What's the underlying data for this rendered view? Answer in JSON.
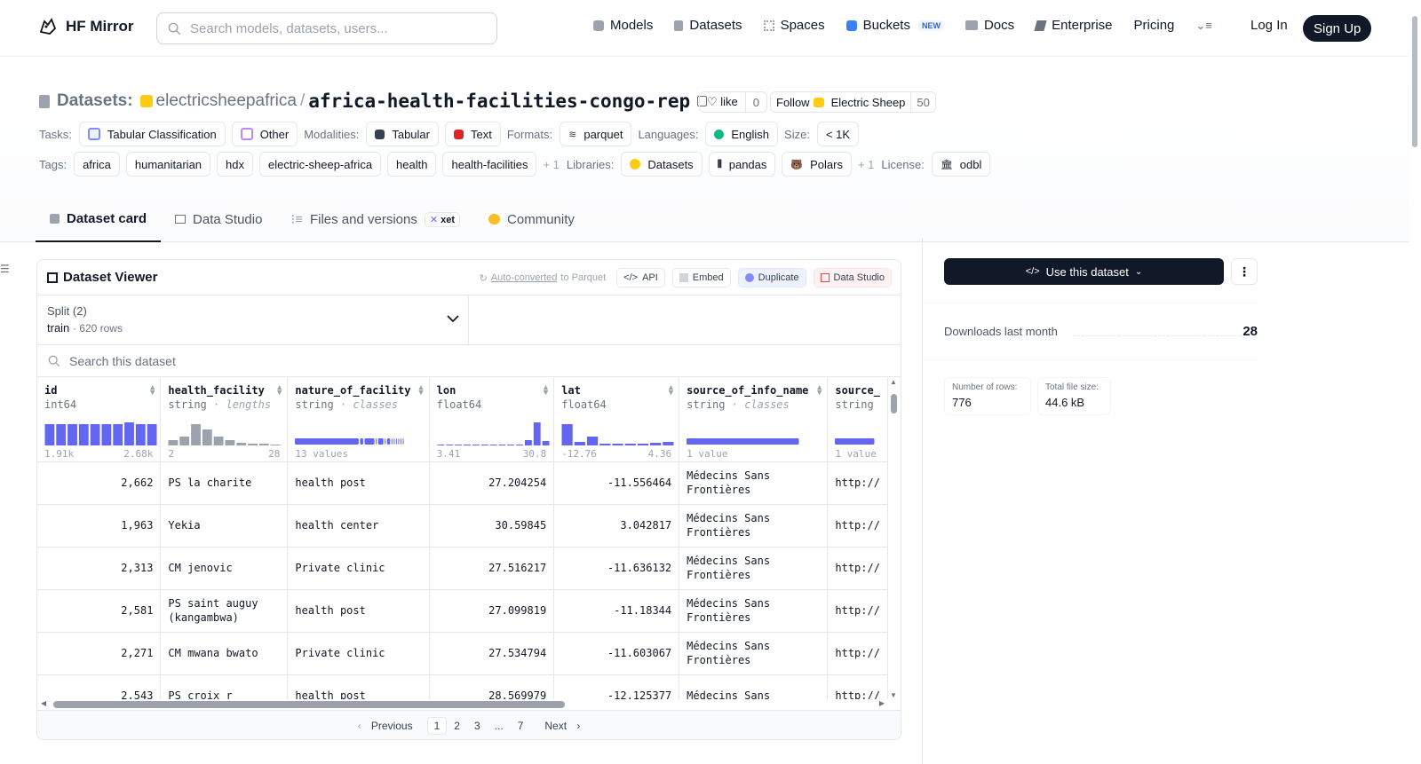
{
  "nav": {
    "brand": "HF Mirror",
    "search_placeholder": "Search models, datasets, users...",
    "links": [
      "Models",
      "Datasets",
      "Spaces",
      "Buckets",
      "Docs",
      "Enterprise",
      "Pricing"
    ],
    "buckets_badge": "NEW",
    "login": "Log In",
    "signup": "Sign Up"
  },
  "header": {
    "type_label": "Datasets:",
    "owner": "electricsheepafrica",
    "separator": "/",
    "name": "africa-health-facilities-congo-rep",
    "like_label": "like",
    "like_count": "0",
    "follow_label": "Follow",
    "follow_org": "Electric Sheep",
    "follow_count": "50"
  },
  "meta": {
    "tasks_label": "Tasks:",
    "tasks": [
      "Tabular Classification",
      "Other"
    ],
    "modalities_label": "Modalities:",
    "modalities": [
      "Tabular",
      "Text"
    ],
    "formats_label": "Formats:",
    "formats": [
      "parquet"
    ],
    "languages_label": "Languages:",
    "languages": [
      "English"
    ],
    "size_label": "Size:",
    "size": "< 1K",
    "tags_label": "Tags:",
    "tags": [
      "africa",
      "humanitarian",
      "hdx",
      "electric-sheep-africa",
      "health",
      "health-facilities"
    ],
    "tags_more": "+ 1",
    "libraries_label": "Libraries:",
    "libraries": [
      "Datasets",
      "pandas",
      "Polars"
    ],
    "libraries_more": "+ 1",
    "license_label": "License:",
    "license": "odbl"
  },
  "tabs": [
    "Dataset card",
    "Data Studio",
    "Files and versions",
    "Community"
  ],
  "xet_badge": "xet",
  "viewer": {
    "title": "Dataset Viewer",
    "auto_converted": "Auto-converted",
    "to_parquet": "to Parquet",
    "api": "API",
    "embed": "Embed",
    "duplicate": "Duplicate",
    "data_studio": "Data Studio",
    "split_label": "Split (2)",
    "split_value": "train",
    "split_rows": "620 rows",
    "search_placeholder": "Search this dataset",
    "columns": [
      {
        "name": "id",
        "type": "int64",
        "kind": "",
        "min": "1.91k",
        "max": "2.68k"
      },
      {
        "name": "health_facility",
        "type": "string",
        "kind": "lengths",
        "min": "2",
        "max": "28"
      },
      {
        "name": "nature_of_facility",
        "type": "string",
        "kind": "classes",
        "min": "13 values",
        "max": ""
      },
      {
        "name": "lon",
        "type": "float64",
        "kind": "",
        "min": "3.41",
        "max": "30.8"
      },
      {
        "name": "lat",
        "type": "float64",
        "kind": "",
        "min": "-12.76",
        "max": "4.36"
      },
      {
        "name": "source_of_info_name",
        "type": "string",
        "kind": "classes",
        "min": "1 value",
        "max": ""
      },
      {
        "name": "source_",
        "type": "string",
        "kind": "",
        "min": "1 value",
        "max": ""
      }
    ],
    "rows": [
      [
        "2,662",
        "PS la charite",
        "health post",
        "27.204254",
        "-11.556464",
        "Médecins Sans Frontières",
        "http://"
      ],
      [
        "1,963",
        "Yekia",
        "health center",
        "30.59845",
        "3.042817",
        "Médecins Sans Frontières",
        "http://"
      ],
      [
        "2,313",
        "CM jenovic",
        "Private clinic",
        "27.516217",
        "-11.636132",
        "Médecins Sans Frontières",
        "http://"
      ],
      [
        "2,581",
        "PS saint auguy (kangambwa)",
        "health post",
        "27.099819",
        "-11.18344",
        "Médecins Sans Frontières",
        "http://"
      ],
      [
        "2,271",
        "CM mwana bwato",
        "Private clinic",
        "27.534794",
        "-11.603067",
        "Médecins Sans Frontières",
        "http://"
      ],
      [
        "2,543",
        "PS croix r",
        "health post",
        "28.569979",
        "-12.125377",
        "Médecins Sans",
        "http://"
      ]
    ],
    "pager": {
      "prev": "Previous",
      "pages": [
        "1",
        "2",
        "3",
        "...",
        "7"
      ],
      "next": "Next"
    }
  },
  "sidebar": {
    "use_button": "Use this dataset",
    "downloads_label": "Downloads last month",
    "downloads_value": "28",
    "rows_label": "Number of rows:",
    "rows_value": "776",
    "size_label": "Total file size:",
    "size_value": "44.6 kB"
  }
}
